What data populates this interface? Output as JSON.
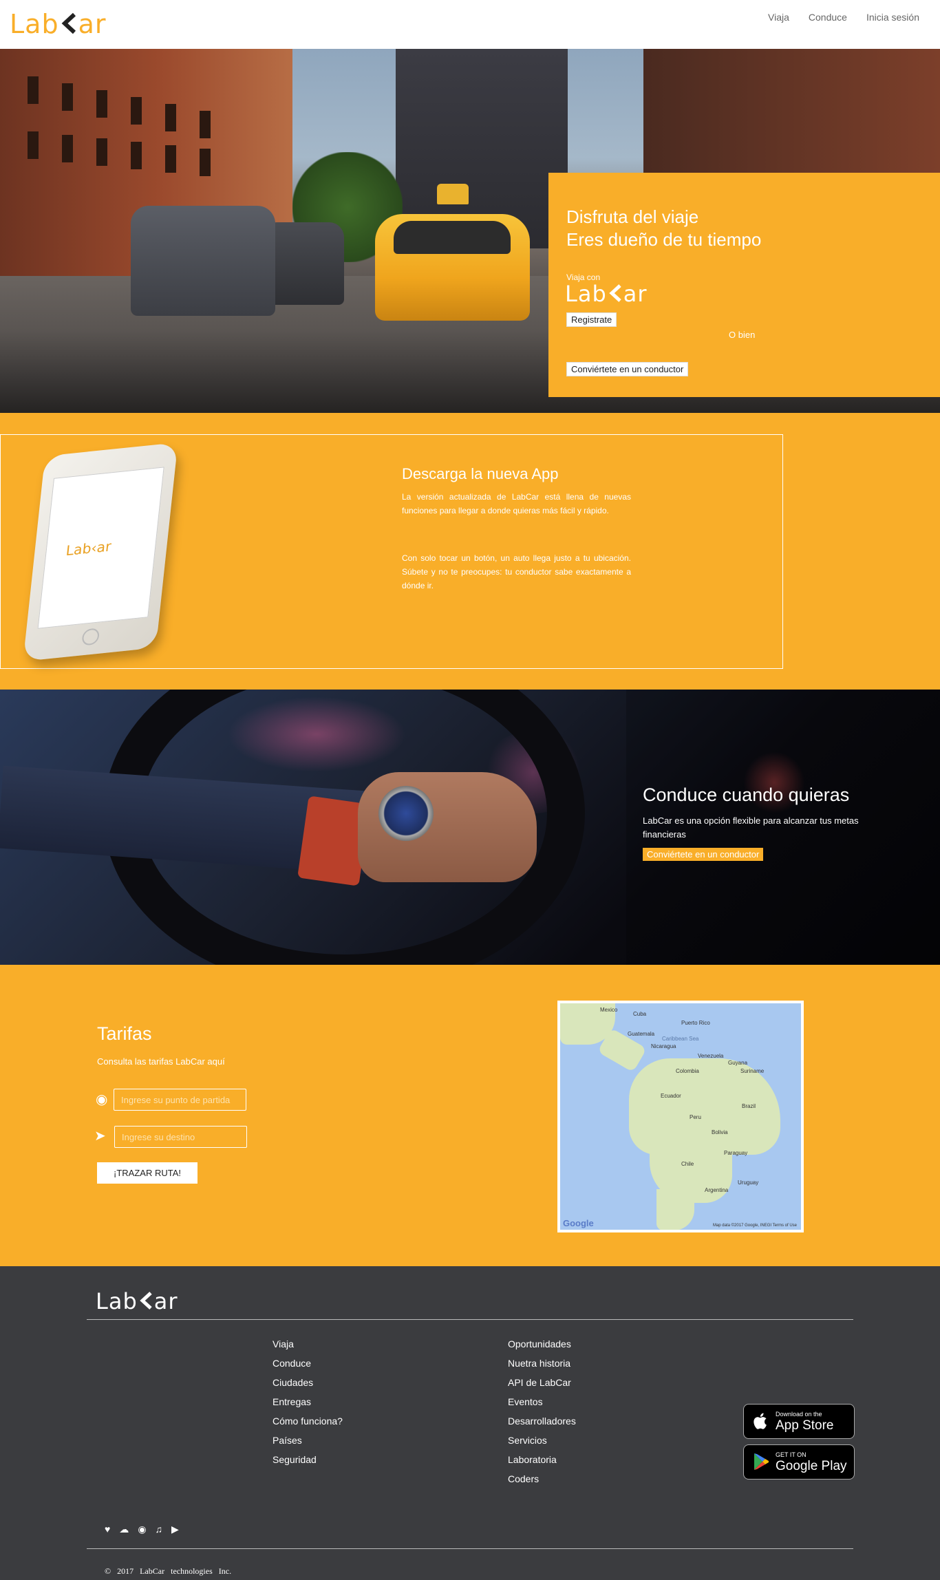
{
  "brand": {
    "name_pre": "Lab",
    "name_post": "ar"
  },
  "nav": {
    "links": [
      "Viaja",
      "Conduce",
      "Inicia sesión"
    ]
  },
  "hero": {
    "title_line1": "Disfruta del viaje",
    "title_line2": "Eres dueño de tu tiempo",
    "viaja_con": "Viaja con",
    "register_label": "Registrate",
    "or_label": "O bien",
    "driver_label": "Conviértete en un conductor"
  },
  "app": {
    "title": "Descarga la nueva App",
    "para1": "La versión actualizada de LabCar está llena de nuevas funciones para llegar a donde quieras más fácil y rápido.",
    "para2": "Con solo tocar un botón, un auto llega justo a tu ubicación. Súbete y no te preocupes: tu conductor sabe exactamente a dónde ir."
  },
  "drive": {
    "title": "Conduce cuando quieras",
    "text": "LabCar es una opción flexible para alcanzar tus metas financieras",
    "button_label": "Conviértete en un conductor"
  },
  "tarifas": {
    "title": "Tarifas",
    "subtitle": "Consulta las tarifas LabCar aquí",
    "origin_placeholder": "Ingrese su punto de partida",
    "destination_placeholder": "Ingrese su destino",
    "route_button": "¡TRAZAR RUTA!",
    "map_labels": [
      "Mexico",
      "Cuba",
      "Puerto Rico",
      "Caribbean Sea",
      "Guatemala",
      "Nicaragua",
      "Venezuela",
      "Colombia",
      "Guyana",
      "Suriname",
      "Ecuador",
      "Peru",
      "Brazil",
      "Bolivia",
      "Paraguay",
      "Chile",
      "Uruguay",
      "Argentina"
    ],
    "map_google": "Google",
    "map_terms": "Map data ©2017 Google, INEGI   Terms of Use"
  },
  "footer": {
    "col1": [
      "Viaja",
      "Conduce",
      "Ciudades",
      "Entregas",
      "Cómo funciona?",
      "Países",
      "Seguridad"
    ],
    "col2": [
      "Oportunidades",
      "Nuetra historia",
      "API de LabCar",
      "Eventos",
      "Desarrolladores",
      "Servicios",
      "Laboratoria",
      "Coders"
    ],
    "appstore_small": "Download on the",
    "appstore_big": "App Store",
    "gplay_small": "GET IT ON",
    "gplay_big": "Google Play",
    "social_icons": [
      "heart-icon",
      "cloud-icon",
      "camera-icon",
      "music-icon",
      "play-icon"
    ],
    "copyright": "2017 LabCar technologies Inc."
  },
  "colors": {
    "accent": "#f9ae29",
    "footer_bg": "#3b3c3f"
  }
}
